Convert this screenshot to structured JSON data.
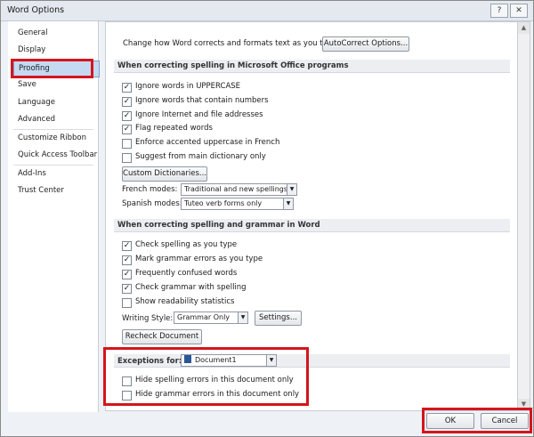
{
  "window": {
    "title": "Word Options",
    "help_glyph": "?",
    "close_glyph": "✕"
  },
  "sidebar": {
    "items": [
      {
        "label": "General"
      },
      {
        "label": "Display"
      },
      {
        "label": "Proofing",
        "selected": true
      },
      {
        "label": "Save"
      },
      {
        "label": "Language"
      },
      {
        "label": "Advanced"
      },
      {
        "label": "Customize Ribbon"
      },
      {
        "label": "Quick Access Toolbar"
      },
      {
        "label": "Add-Ins"
      },
      {
        "label": "Trust Center"
      }
    ]
  },
  "autocorrect": {
    "text": "Change how Word corrects and formats text as you type:",
    "button": "AutoCorrect Options..."
  },
  "office_spelling": {
    "header": "When correcting spelling in Microsoft Office programs",
    "options": [
      {
        "label": "Ignore words in UPPERCASE",
        "checked": true
      },
      {
        "label": "Ignore words that contain numbers",
        "checked": true
      },
      {
        "label": "Ignore Internet and file addresses",
        "checked": true
      },
      {
        "label": "Flag repeated words",
        "checked": true
      },
      {
        "label": "Enforce accented uppercase in French",
        "checked": false
      },
      {
        "label": "Suggest from main dictionary only",
        "checked": false
      }
    ],
    "custom_dictionaries_button": "Custom Dictionaries...",
    "french_modes_label": "French modes:",
    "french_modes_value": "Traditional and new spellings",
    "spanish_modes_label": "Spanish modes:",
    "spanish_modes_value": "Tuteo verb forms only"
  },
  "word_spelling": {
    "header": "When correcting spelling and grammar in Word",
    "options": [
      {
        "label": "Check spelling as you type",
        "checked": true
      },
      {
        "label": "Mark grammar errors as you type",
        "checked": true
      },
      {
        "label": "Frequently confused words",
        "checked": true
      },
      {
        "label": "Check grammar with spelling",
        "checked": true
      },
      {
        "label": "Show readability statistics",
        "checked": false
      }
    ],
    "writing_style_label": "Writing Style:",
    "writing_style_value": "Grammar Only",
    "settings_button": "Settings...",
    "recheck_button": "Recheck Document"
  },
  "exceptions": {
    "label": "Exceptions for:",
    "document": "Document1",
    "options": [
      {
        "label": "Hide spelling errors in this document only",
        "checked": false
      },
      {
        "label": "Hide grammar errors in this document only",
        "checked": false
      }
    ]
  },
  "footer": {
    "ok": "OK",
    "cancel": "Cancel"
  },
  "accent": {
    "highlight": "#d4151d",
    "selection": "#c5d9f1"
  }
}
